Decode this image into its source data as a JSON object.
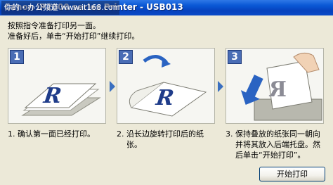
{
  "window": {
    "title": "Canon iP2000 series Printer - USB013",
    "watermark": "你的・办公频道 www.it168.com"
  },
  "instructions": [
    "按照指令准备打印另一面。",
    "准备好后，单击“开始打印”继续打印。"
  ],
  "steps": [
    {
      "number": "1",
      "caption_lines": [
        "1. 确认第一面已经打印。"
      ]
    },
    {
      "number": "2",
      "caption_lines": [
        "2. 沿长边旋转打印后的纸",
        "张。"
      ]
    },
    {
      "number": "3",
      "caption_lines": [
        "3. 保持叠放的纸张同一朝向",
        "并将其放入后端托盘。然",
        "后单击“开始打印”。"
      ]
    }
  ],
  "paper_glyph": "R",
  "buttons": {
    "start_print": "开始打印"
  },
  "colors": {
    "titlebar": "#0a58d6",
    "badge": "#4a6db5",
    "arrow": "#3a6fc0",
    "dialog_bg": "#ece9d8"
  }
}
